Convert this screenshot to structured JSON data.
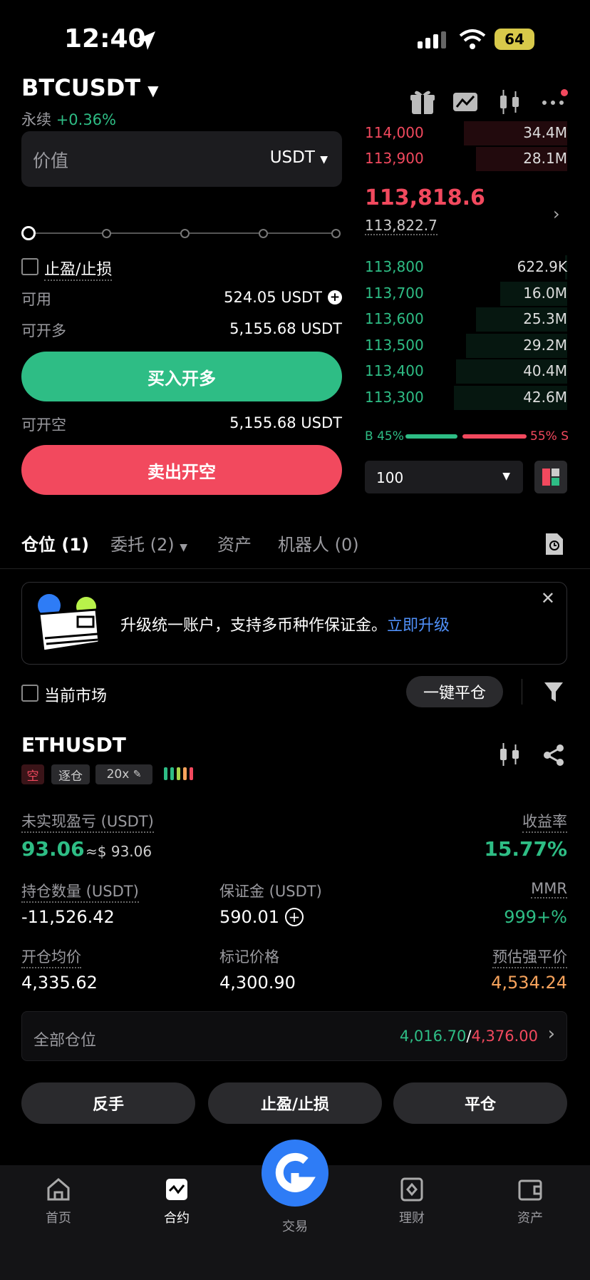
{
  "status_bar": {
    "time": "12:40",
    "battery": "64"
  },
  "header": {
    "symbol": "BTCUSDT",
    "contract_type": "永续",
    "change": "+0.36%"
  },
  "order_form": {
    "value_label": "价值",
    "unit": "USDT",
    "tpsl_label": "止盈/止损",
    "available_label": "可用",
    "available_value": "524.05 USDT",
    "long_max_label": "可开多",
    "long_max_value": "5,155.68 USDT",
    "buy_button": "买入开多",
    "short_max_label": "可开空",
    "short_max_value": "5,155.68 USDT",
    "sell_button": "卖出开空"
  },
  "order_book": {
    "asks": [
      {
        "price": "114,000",
        "qty": "34.4M",
        "depth": 0.51
      },
      {
        "price": "113,900",
        "qty": "28.1M",
        "depth": 0.45
      }
    ],
    "last_price": "113,818.6",
    "mark_price": "113,822.7",
    "bids": [
      {
        "price": "113,800",
        "qty": "622.9K",
        "depth": 0.01
      },
      {
        "price": "113,700",
        "qty": "16.0M",
        "depth": 0.33
      },
      {
        "price": "113,600",
        "qty": "25.3M",
        "depth": 0.45
      },
      {
        "price": "113,500",
        "qty": "29.2M",
        "depth": 0.5
      },
      {
        "price": "113,400",
        "qty": "40.4M",
        "depth": 0.55
      },
      {
        "price": "113,300",
        "qty": "42.6M",
        "depth": 0.56
      }
    ],
    "buy_ratio": "B 45%",
    "sell_ratio": "55% S",
    "buy_fraction": 0.45,
    "depth_select": "100"
  },
  "tabs": {
    "positions": "仓位 (1)",
    "orders": "委托 (2)",
    "assets": "资产",
    "bots": "机器人 (0)"
  },
  "banner": {
    "text": "升级统一账户，支持多币种作保证金。",
    "link": "立即升级"
  },
  "filters": {
    "current_market": "当前市场",
    "close_all": "一键平仓"
  },
  "position": {
    "symbol": "ETHUSDT",
    "side": "空",
    "margin_mode": "逐仓",
    "leverage": "20x",
    "upnl_label": "未实现盈亏 (USDT)",
    "upnl_value": "93.06",
    "upnl_usd": "≈$ 93.06",
    "roe_label": "收益率",
    "roe_value": "15.77%",
    "size_label": "持仓数量 (USDT)",
    "size_value": "-11,526.42",
    "margin_label": "保证金 (USDT)",
    "margin_value": "590.01",
    "mmr_label": "MMR",
    "mmr_value": "999+%",
    "entry_label": "开仓均价",
    "entry_value": "4,335.62",
    "mark_label": "标记价格",
    "mark_value": "4,300.90",
    "liq_label": "预估强平价",
    "liq_value": "4,534.24",
    "all_positions_label": "全部仓位",
    "all_long": "4,016.70",
    "all_sep": "/",
    "all_short": "4,376.00"
  },
  "actions": {
    "reverse": "反手",
    "tpsl": "止盈/止损",
    "close": "平仓"
  },
  "bottom_nav": {
    "home": "首页",
    "futures": "合约",
    "trade": "交易",
    "earn": "理财",
    "assets": "资产"
  },
  "colors": {
    "green": "#2ebd85",
    "red": "#f2495e",
    "blue": "#2e7cf6",
    "orange": "#f7a35c"
  }
}
